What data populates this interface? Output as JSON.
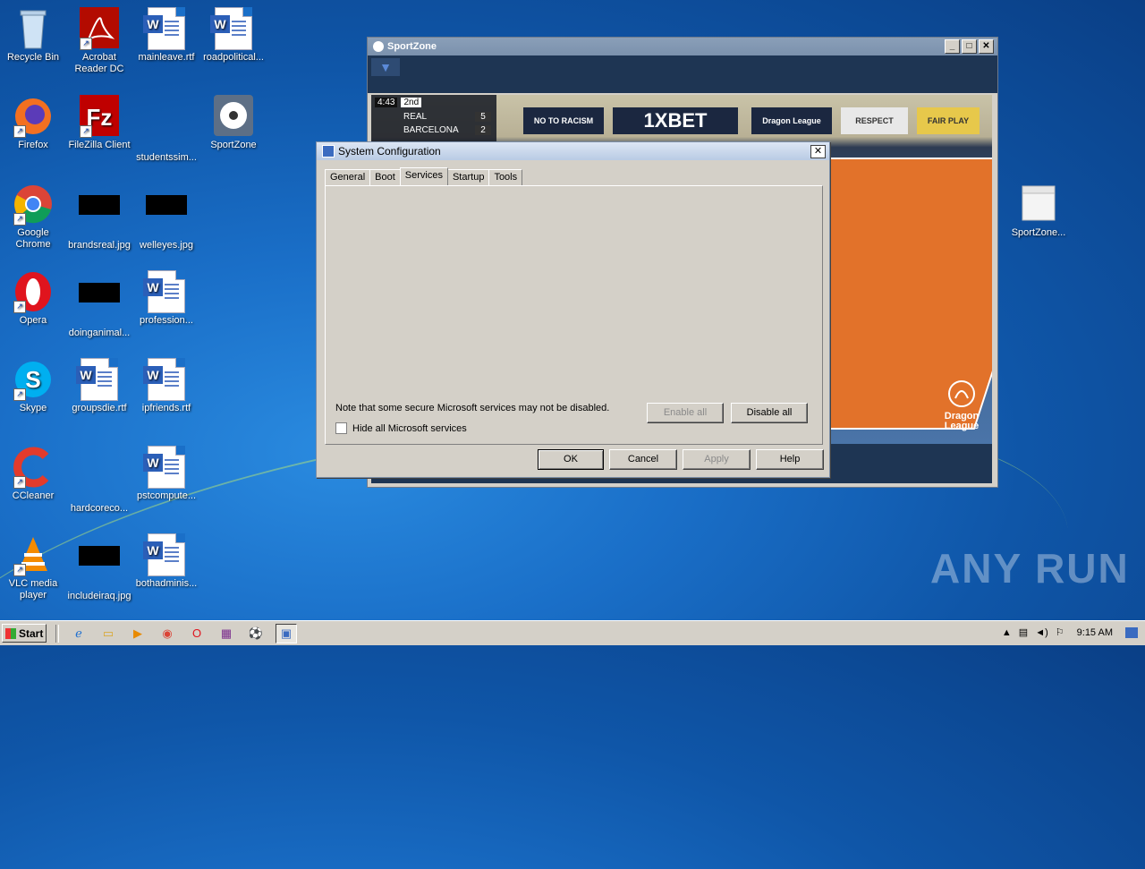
{
  "desktop": {
    "icons": [
      {
        "label": "Recycle Bin"
      },
      {
        "label": "Acrobat Reader DC"
      },
      {
        "label": "mainleave.rtf"
      },
      {
        "label": "roadpolitical..."
      },
      {
        "label": "Firefox"
      },
      {
        "label": "FileZilla Client"
      },
      {
        "label": "studentssim..."
      },
      {
        "label": "SportZone"
      },
      {
        "label": "Google Chrome"
      },
      {
        "label": "brandsreal.jpg"
      },
      {
        "label": "welleyes.jpg"
      },
      {
        "label": "Opera"
      },
      {
        "label": "doinganimal..."
      },
      {
        "label": "profession..."
      },
      {
        "label": "Skype"
      },
      {
        "label": "groupsdie.rtf"
      },
      {
        "label": "ipfriends.rtf"
      },
      {
        "label": "CCleaner"
      },
      {
        "label": "hardcoreco..."
      },
      {
        "label": "pstcompute..."
      },
      {
        "label": "VLC media player"
      },
      {
        "label": "includeiraq.jpg"
      },
      {
        "label": "bothadminis..."
      },
      {
        "label": "SportZone..."
      }
    ]
  },
  "sportzone": {
    "title": "SportZone",
    "scoreboard": {
      "time": "4:43",
      "period": "2nd",
      "team1": "REAL",
      "score1": "5",
      "team2": "BARCELONA",
      "score2": "2"
    },
    "banners": [
      "NO TO RACISM",
      "1XBET",
      "Dragon League",
      "RESPECT",
      "FAIR PLAY"
    ],
    "logo": "Dragon League"
  },
  "dialog": {
    "title": "System Configuration",
    "tabs": [
      "General",
      "Boot",
      "Services",
      "Startup",
      "Tools"
    ],
    "active_tab": "Services",
    "note": "Note that some secure Microsoft services may not be disabled.",
    "hide_ms_label": "Hide all Microsoft services",
    "enable_all": "Enable all",
    "disable_all": "Disable all",
    "ok": "OK",
    "cancel": "Cancel",
    "apply": "Apply",
    "help": "Help"
  },
  "taskbar": {
    "start_label": "Start",
    "clock": "9:15 AM"
  },
  "watermark": "ANY RUN"
}
